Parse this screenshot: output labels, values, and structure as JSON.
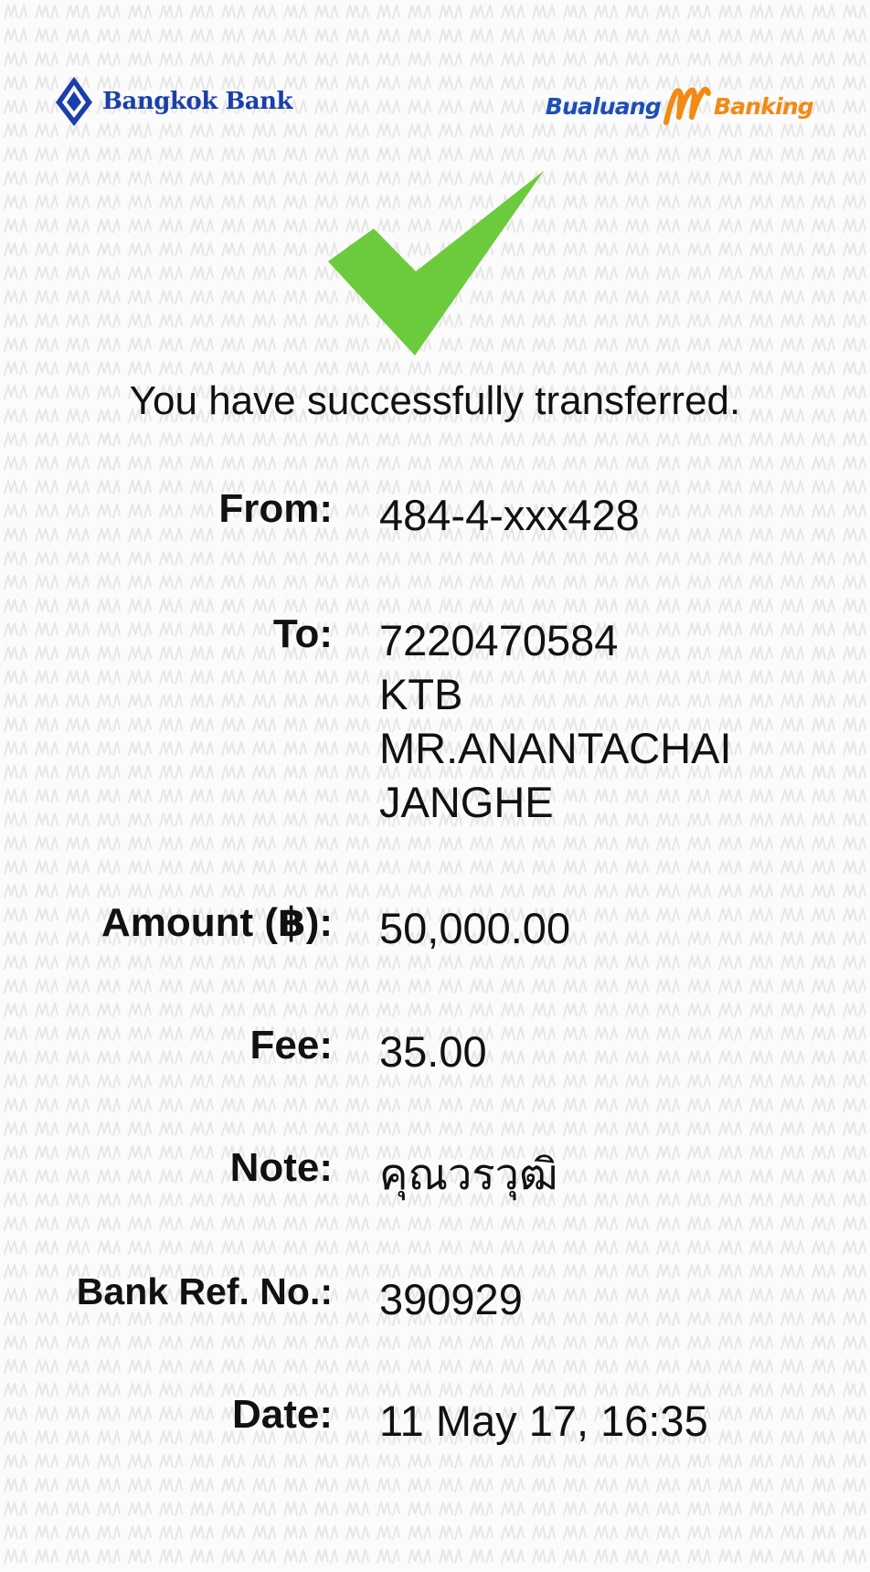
{
  "header": {
    "bank_name": "Bangkok Bank",
    "app_brand_left": "Bualuang",
    "app_brand_right": "Banking"
  },
  "status": {
    "message": "You have successfully transferred.",
    "icon": "check-icon",
    "icon_color": "#6ccb3c"
  },
  "details": {
    "from": {
      "label": "From:",
      "value": "484-4-xxx428"
    },
    "to": {
      "label": "To:",
      "lines": [
        "7220470584",
        "KTB",
        "MR.ANANTACHAI",
        "JANGHE"
      ]
    },
    "amount": {
      "label": "Amount (฿):",
      "value": "50,000.00"
    },
    "fee": {
      "label": "Fee:",
      "value": "35.00"
    },
    "note": {
      "label": "Note:",
      "value": "คุณวรวุฒิ"
    },
    "bank_ref": {
      "label": "Bank Ref. No.:",
      "value": "390929"
    },
    "date": {
      "label": "Date:",
      "value": "11 May 17, 16:35"
    }
  },
  "colors": {
    "bangkok_bank_blue": "#1a3fa8",
    "bualuang_blue": "#1d4fb5",
    "mbanking_orange": "#f28a14",
    "background": "#fbfbfb"
  }
}
